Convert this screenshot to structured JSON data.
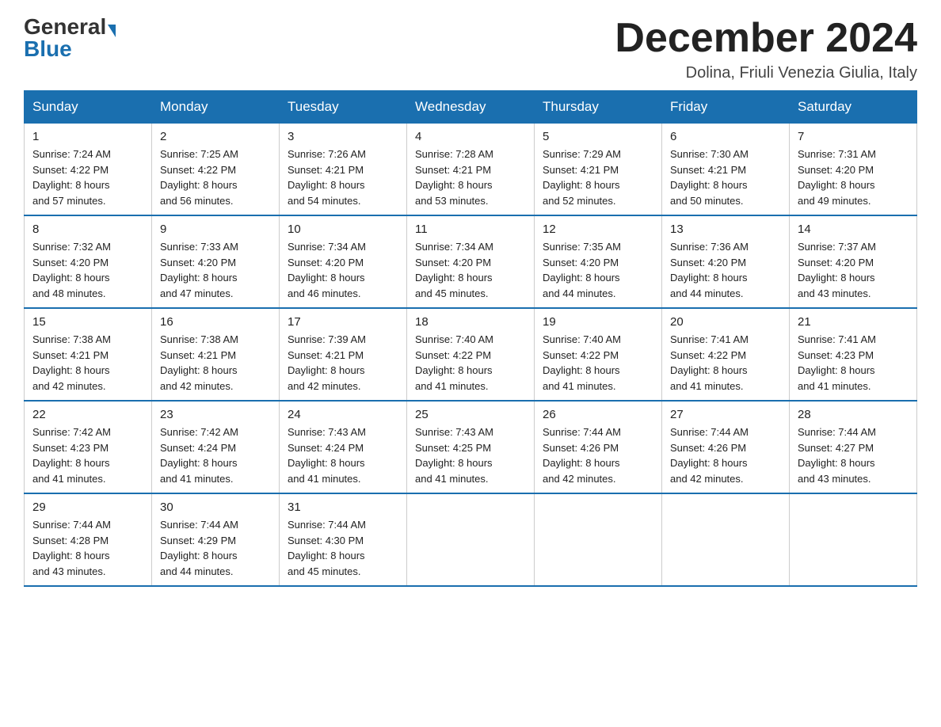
{
  "logo": {
    "general": "General",
    "blue": "Blue"
  },
  "title": "December 2024",
  "subtitle": "Dolina, Friuli Venezia Giulia, Italy",
  "days_of_week": [
    "Sunday",
    "Monday",
    "Tuesday",
    "Wednesday",
    "Thursday",
    "Friday",
    "Saturday"
  ],
  "weeks": [
    [
      {
        "day": "1",
        "sunrise": "7:24 AM",
        "sunset": "4:22 PM",
        "daylight": "8 hours and 57 minutes."
      },
      {
        "day": "2",
        "sunrise": "7:25 AM",
        "sunset": "4:22 PM",
        "daylight": "8 hours and 56 minutes."
      },
      {
        "day": "3",
        "sunrise": "7:26 AM",
        "sunset": "4:21 PM",
        "daylight": "8 hours and 54 minutes."
      },
      {
        "day": "4",
        "sunrise": "7:28 AM",
        "sunset": "4:21 PM",
        "daylight": "8 hours and 53 minutes."
      },
      {
        "day": "5",
        "sunrise": "7:29 AM",
        "sunset": "4:21 PM",
        "daylight": "8 hours and 52 minutes."
      },
      {
        "day": "6",
        "sunrise": "7:30 AM",
        "sunset": "4:21 PM",
        "daylight": "8 hours and 50 minutes."
      },
      {
        "day": "7",
        "sunrise": "7:31 AM",
        "sunset": "4:20 PM",
        "daylight": "8 hours and 49 minutes."
      }
    ],
    [
      {
        "day": "8",
        "sunrise": "7:32 AM",
        "sunset": "4:20 PM",
        "daylight": "8 hours and 48 minutes."
      },
      {
        "day": "9",
        "sunrise": "7:33 AM",
        "sunset": "4:20 PM",
        "daylight": "8 hours and 47 minutes."
      },
      {
        "day": "10",
        "sunrise": "7:34 AM",
        "sunset": "4:20 PM",
        "daylight": "8 hours and 46 minutes."
      },
      {
        "day": "11",
        "sunrise": "7:34 AM",
        "sunset": "4:20 PM",
        "daylight": "8 hours and 45 minutes."
      },
      {
        "day": "12",
        "sunrise": "7:35 AM",
        "sunset": "4:20 PM",
        "daylight": "8 hours and 44 minutes."
      },
      {
        "day": "13",
        "sunrise": "7:36 AM",
        "sunset": "4:20 PM",
        "daylight": "8 hours and 44 minutes."
      },
      {
        "day": "14",
        "sunrise": "7:37 AM",
        "sunset": "4:20 PM",
        "daylight": "8 hours and 43 minutes."
      }
    ],
    [
      {
        "day": "15",
        "sunrise": "7:38 AM",
        "sunset": "4:21 PM",
        "daylight": "8 hours and 42 minutes."
      },
      {
        "day": "16",
        "sunrise": "7:38 AM",
        "sunset": "4:21 PM",
        "daylight": "8 hours and 42 minutes."
      },
      {
        "day": "17",
        "sunrise": "7:39 AM",
        "sunset": "4:21 PM",
        "daylight": "8 hours and 42 minutes."
      },
      {
        "day": "18",
        "sunrise": "7:40 AM",
        "sunset": "4:22 PM",
        "daylight": "8 hours and 41 minutes."
      },
      {
        "day": "19",
        "sunrise": "7:40 AM",
        "sunset": "4:22 PM",
        "daylight": "8 hours and 41 minutes."
      },
      {
        "day": "20",
        "sunrise": "7:41 AM",
        "sunset": "4:22 PM",
        "daylight": "8 hours and 41 minutes."
      },
      {
        "day": "21",
        "sunrise": "7:41 AM",
        "sunset": "4:23 PM",
        "daylight": "8 hours and 41 minutes."
      }
    ],
    [
      {
        "day": "22",
        "sunrise": "7:42 AM",
        "sunset": "4:23 PM",
        "daylight": "8 hours and 41 minutes."
      },
      {
        "day": "23",
        "sunrise": "7:42 AM",
        "sunset": "4:24 PM",
        "daylight": "8 hours and 41 minutes."
      },
      {
        "day": "24",
        "sunrise": "7:43 AM",
        "sunset": "4:24 PM",
        "daylight": "8 hours and 41 minutes."
      },
      {
        "day": "25",
        "sunrise": "7:43 AM",
        "sunset": "4:25 PM",
        "daylight": "8 hours and 41 minutes."
      },
      {
        "day": "26",
        "sunrise": "7:44 AM",
        "sunset": "4:26 PM",
        "daylight": "8 hours and 42 minutes."
      },
      {
        "day": "27",
        "sunrise": "7:44 AM",
        "sunset": "4:26 PM",
        "daylight": "8 hours and 42 minutes."
      },
      {
        "day": "28",
        "sunrise": "7:44 AM",
        "sunset": "4:27 PM",
        "daylight": "8 hours and 43 minutes."
      }
    ],
    [
      {
        "day": "29",
        "sunrise": "7:44 AM",
        "sunset": "4:28 PM",
        "daylight": "8 hours and 43 minutes."
      },
      {
        "day": "30",
        "sunrise": "7:44 AM",
        "sunset": "4:29 PM",
        "daylight": "8 hours and 44 minutes."
      },
      {
        "day": "31",
        "sunrise": "7:44 AM",
        "sunset": "4:30 PM",
        "daylight": "8 hours and 45 minutes."
      },
      null,
      null,
      null,
      null
    ]
  ],
  "sunrise_label": "Sunrise:",
  "sunset_label": "Sunset:",
  "daylight_label": "Daylight:"
}
